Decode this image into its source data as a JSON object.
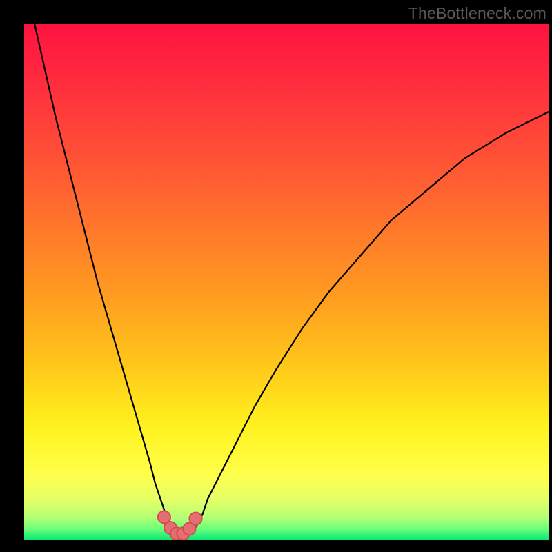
{
  "watermark": "TheBottleneck.com",
  "colors": {
    "black": "#000000",
    "curve": "#000000",
    "marker_fill": "#e46e71",
    "marker_stroke": "#d44a4e",
    "gradient_stops": [
      {
        "offset": 0.0,
        "color": "#ff1240"
      },
      {
        "offset": 0.12,
        "color": "#ff2e3e"
      },
      {
        "offset": 0.25,
        "color": "#ff4f36"
      },
      {
        "offset": 0.38,
        "color": "#ff732c"
      },
      {
        "offset": 0.52,
        "color": "#ff9a20"
      },
      {
        "offset": 0.66,
        "color": "#ffc71a"
      },
      {
        "offset": 0.78,
        "color": "#fff21e"
      },
      {
        "offset": 0.87,
        "color": "#ffff4a"
      },
      {
        "offset": 0.92,
        "color": "#e6ff66"
      },
      {
        "offset": 0.955,
        "color": "#b6ff74"
      },
      {
        "offset": 0.978,
        "color": "#6dff7a"
      },
      {
        "offset": 1.0,
        "color": "#00e876"
      }
    ]
  },
  "chart_data": {
    "type": "line",
    "title": "",
    "xlabel": "",
    "ylabel": "",
    "xlim": [
      0,
      100
    ],
    "ylim": [
      0,
      100
    ],
    "grid": false,
    "legend": false,
    "series": [
      {
        "name": "left-branch",
        "x": [
          2,
          4,
          6,
          8,
          10,
          12,
          14,
          16,
          18,
          20,
          22,
          24,
          25,
          26,
          27,
          27.5,
          28
        ],
        "y": [
          100,
          91,
          82,
          74,
          66,
          58,
          50,
          43,
          36,
          29,
          22,
          15,
          11,
          8,
          5,
          3,
          1.5
        ]
      },
      {
        "name": "right-branch",
        "x": [
          32,
          33,
          34,
          35,
          37,
          40,
          44,
          48,
          53,
          58,
          64,
          70,
          77,
          84,
          92,
          100
        ],
        "y": [
          1.5,
          3,
          5,
          8,
          12,
          18,
          26,
          33,
          41,
          48,
          55,
          62,
          68,
          74,
          79,
          83
        ]
      },
      {
        "name": "valley-floor",
        "x": [
          26.7,
          27.5,
          28.3,
          29.2,
          30.2,
          31.2,
          32.0,
          32.7
        ],
        "y": [
          4.5,
          2.8,
          1.7,
          1.2,
          1.2,
          1.6,
          2.6,
          4.2
        ]
      }
    ],
    "markers": {
      "name": "bottleneck-markers",
      "x": [
        26.7,
        27.9,
        29.1,
        30.3,
        31.5,
        32.7
      ],
      "y": [
        4.5,
        2.4,
        1.3,
        1.3,
        2.2,
        4.2
      ],
      "r": 1.2
    }
  }
}
